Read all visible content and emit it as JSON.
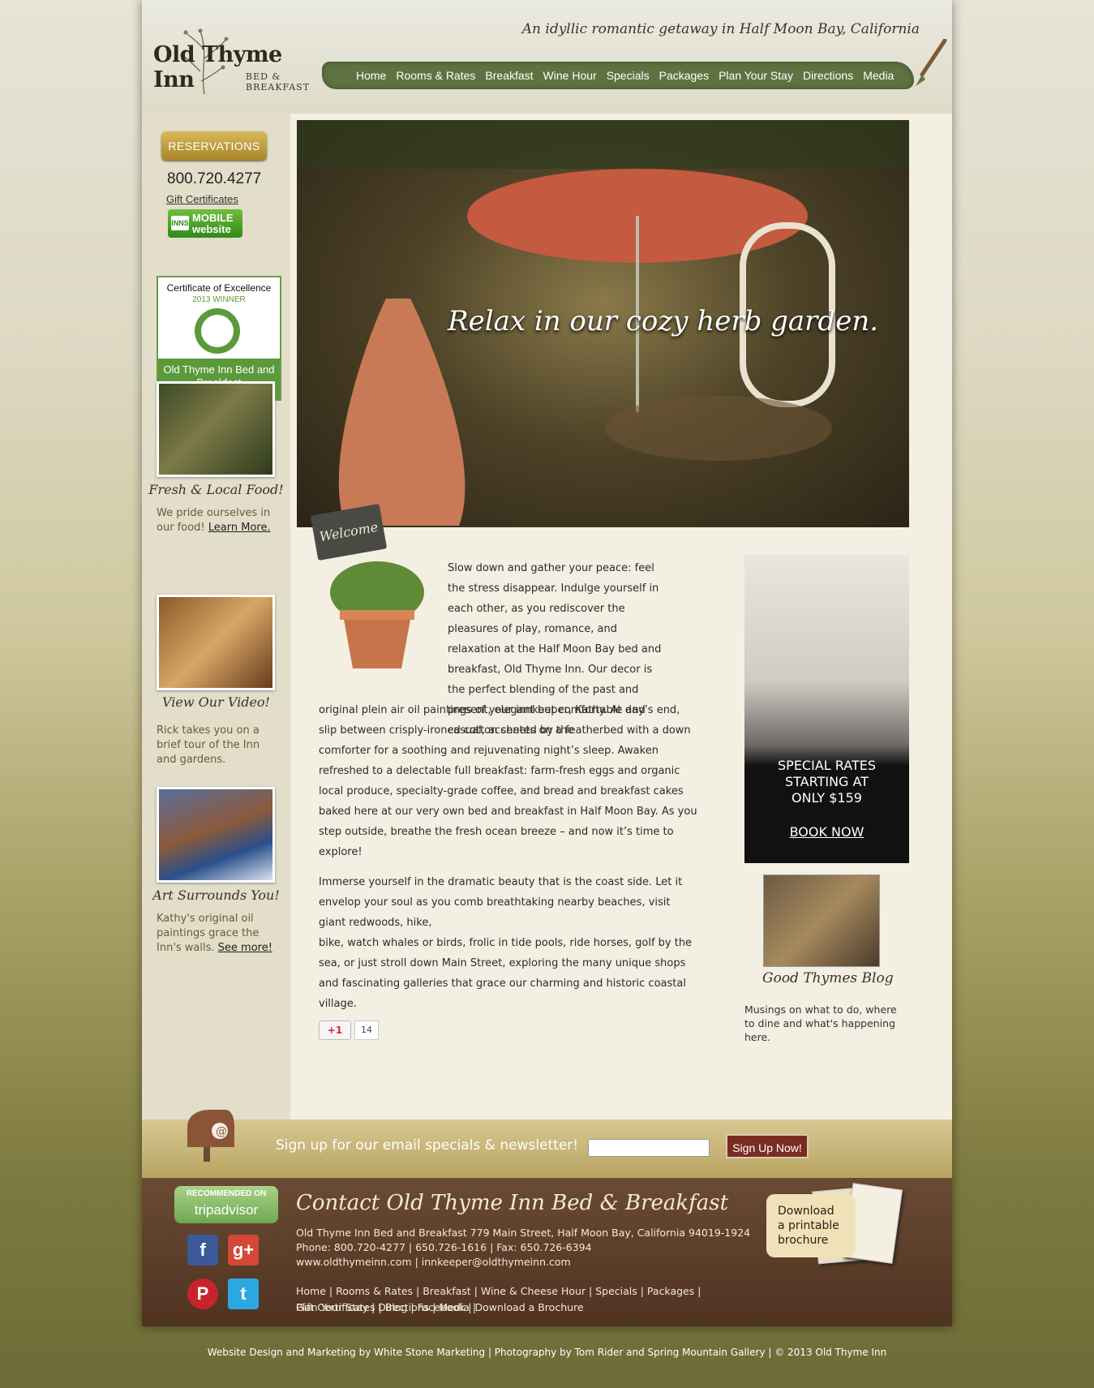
{
  "header": {
    "logo_name": "Old Thyme Inn",
    "logo_sub_1": "BED &",
    "logo_sub_2": "BREAKFAST",
    "tagline": "An idyllic romantic getaway in Half Moon Bay, California"
  },
  "nav": [
    "Home",
    "Rooms & Rates",
    "Breakfast",
    "Wine Hour",
    "Specials",
    "Packages",
    "Plan Your Stay",
    "Directions",
    "Media"
  ],
  "sidebar": {
    "reservations": "RESERVATIONS",
    "phone": "800.720.4277",
    "gift": "Gift Certificates",
    "mobile_1": "MOBILE",
    "mobile_2": "website",
    "mobile_icon": "INNS",
    "cert_title": "Certificate of Excellence",
    "cert_year": "2013 WINNER",
    "cert_name": "Old Thyme Inn Bed and Breakfast",
    "food_title": "Fresh & Local Food!",
    "food_text": "We pride ourselves in our food!",
    "food_link": "Learn More.",
    "video_title": "View Our Video!",
    "video_text": "Rick takes you on a brief tour of the Inn and gardens.",
    "art_title": "Art Surrounds You!",
    "art_text": "Kathy's original oil paintings grace the Inn's walls.",
    "art_link": "See more!"
  },
  "hero": {
    "caption": "Relax in our cozy herb garden."
  },
  "welcome_sign": "Welcome",
  "main": {
    "para1_a": "Slow down and gather your peace: feel the stress disappear. Indulge yourself in each other, as you rediscover the pleasures of play, romance, and relaxation at the Half Moon Bay bed and breakfast, Old Thyme Inn. Our decor is the perfect blending of the past and present, elegant but comfortable and casual, accented by the",
    "para1_b": "original plein air oil paintings of your innkeeper, Kathy. At day’s end, slip between crisply-ironed cotton sheets on a featherbed with a down comforter for a soothing and rejuvenating night’s sleep. Awaken refreshed to a delectable full breakfast: farm-fresh eggs and organic local produce, specialty-grade coffee, and bread and breakfast cakes baked here at our very own bed and breakfast in Half Moon Bay. As you step outside, breathe the fresh ocean breeze – and now it’s time to explore!",
    "para2_a": "Immerse yourself in the dramatic beauty that is the coast side. Let it envelop your soul as you comb breathtaking nearby beaches, visit giant redwoods, hike,",
    "para2_b": "bike, watch whales or birds, frolic in tide pools, ride horses, golf by the sea, or just stroll down Main Street, exploring the many unique shops and fascinating galleries that grace our charming and historic coastal village.",
    "gplus_label": "+1",
    "gplus_count": "14"
  },
  "promo": {
    "line1": "SPECIAL RATES",
    "line2": "STARTING AT",
    "line3": "ONLY $159",
    "book": "BOOK NOW"
  },
  "blog": {
    "title": "Good Thymes Blog",
    "text": "Musings on what to do, where to dine and what's happening here."
  },
  "newsletter": {
    "label": "Sign up for our email specials & newsletter!",
    "button": "Sign Up Now!",
    "input_value": ""
  },
  "footer": {
    "ta_rec": "RECOMMENDED ON",
    "ta_name": "tripadvisor",
    "title": "Contact Old Thyme Inn Bed & Breakfast",
    "address": "Old Thyme Inn Bed and Breakfast 779 Main Street, Half Moon Bay, California 94019-1924",
    "phones": "Phone: 800.720-4277 | 650.726-1616 | Fax: 650.726-6394",
    "web": "www.oldthymeinn.com | innkeeper@oldthymeinn.com",
    "nav_line1": "Home | Rooms & Rates | Breakfast | Wine & Cheese Hour | Specials | Packages | Plan Your Stay | Directions | Media |",
    "nav_line2": "Gift Certificates | Blog | Facebook | Download a Brochure",
    "brochure_1": "Download",
    "brochure_2": "a printable",
    "brochure_3": "brochure"
  },
  "credit": "Website Design and Marketing by White Stone Marketing | Photography by Tom Rider and Spring Mountain Gallery | © 2013 Old Thyme Inn"
}
